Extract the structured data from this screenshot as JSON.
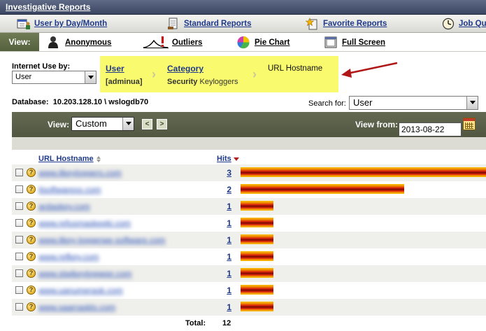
{
  "title": "Investigative Reports",
  "menu": {
    "user_by_day": "User by Day/Month",
    "standard_reports": "Standard Reports",
    "favorite_reports": "Favorite Reports",
    "job_queue": "Job Qu"
  },
  "viewbar": {
    "label": "View:",
    "anonymous": "Anonymous",
    "outliers": "Outliers",
    "pie_chart": "Pie Chart",
    "full_screen": "Full Screen"
  },
  "internet_use": {
    "label": "Internet Use by:",
    "selected": "User"
  },
  "breadcrumb": {
    "user_link": "User",
    "user_value": "[adminua]",
    "category_link": "Category",
    "category_value_bold": "Security",
    "category_value": "Keyloggers",
    "current": "URL Hostname"
  },
  "database": {
    "label": "Database:",
    "value": "10.203.128.10 \\ wslogdb70"
  },
  "search": {
    "label": "Search for:",
    "selected": "User"
  },
  "controls": {
    "view_label": "View:",
    "view_selected": "Custom",
    "view_from_label": "View from:",
    "view_from_date": "2013-08-22"
  },
  "table": {
    "col_host": "URL Hostname",
    "col_hits": "Hits",
    "max_hits": 3,
    "rows": [
      {
        "host": "www.itkeyloggers.com",
        "hits": 3
      },
      {
        "host": "itsoftwarexx.com",
        "hits": 2
      },
      {
        "host": "ardaskey.com",
        "hits": 1
      },
      {
        "host": "www.refusmaskeeki.com",
        "hits": 1
      },
      {
        "host": "www.itkey-loggerwe-software.com",
        "hits": 1
      },
      {
        "host": "www.refkey.com",
        "hits": 1
      },
      {
        "host": "www.stwikeyloggeer.com",
        "hits": 1
      },
      {
        "host": "www.uanumerask.com",
        "hits": 1
      },
      {
        "host": "www.saarrasklo.com",
        "hits": 1
      }
    ],
    "total_label": "Total:",
    "total_value": "12"
  },
  "colors": {
    "titlebar": "#4a5574",
    "breadcrumb_bg": "#fafa6e",
    "control_bar": "#5a6048",
    "link": "#1f3a8a",
    "bar": "#d8200c",
    "arrow": "#b01818"
  }
}
